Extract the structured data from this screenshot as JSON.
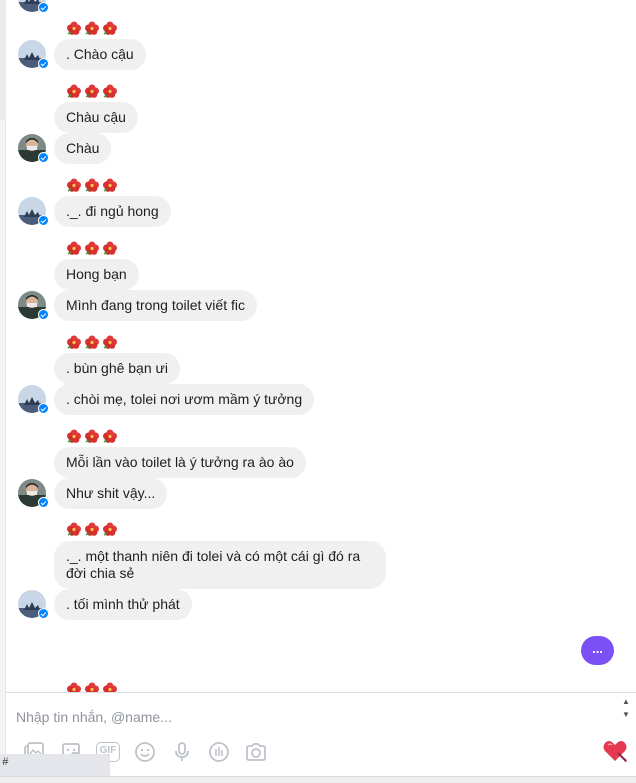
{
  "messages": [
    {
      "text": ". Chào cậu"
    },
    {
      "text": "Chàu cậu"
    },
    {
      "text": "Chàu"
    },
    {
      "text": "._. đi ngủ hong"
    },
    {
      "text": "Hong bạn"
    },
    {
      "text": "Mình đang trong toilet viết fic"
    },
    {
      "text": ". bùn ghê bạn ưi"
    },
    {
      "text": ". chòi mẹ, tolei nơi ươm mầm ý tưởng"
    },
    {
      "text": "Mỗi lần vào toilet là ý tưởng ra ào ào"
    },
    {
      "text": "Như shit vậy..."
    },
    {
      "text": "._. một thanh niên đi tolei và có một cái gì đó ra đời chia sẻ"
    },
    {
      "text": ". tối mình thử phát"
    }
  ],
  "typing_indicator": "...",
  "composer": {
    "placeholder": "Nhập tin nhắn, @name...",
    "gif_label": "GIF",
    "scroll_up": "▲",
    "scroll_down": "▼"
  },
  "toolbar_icons": [
    "photo-icon",
    "sticker-icon",
    "gif-icon",
    "emoji-icon",
    "microphone-icon",
    "audio-clip-icon",
    "camera-icon"
  ],
  "bottom_bar_text": "#",
  "colors": {
    "bubble": "#f1f0f0",
    "accent": "#7b50f4",
    "badge": "#0084ff",
    "flower": "#e0393b",
    "icon": "#bec3c9",
    "heart": "#e53950"
  }
}
